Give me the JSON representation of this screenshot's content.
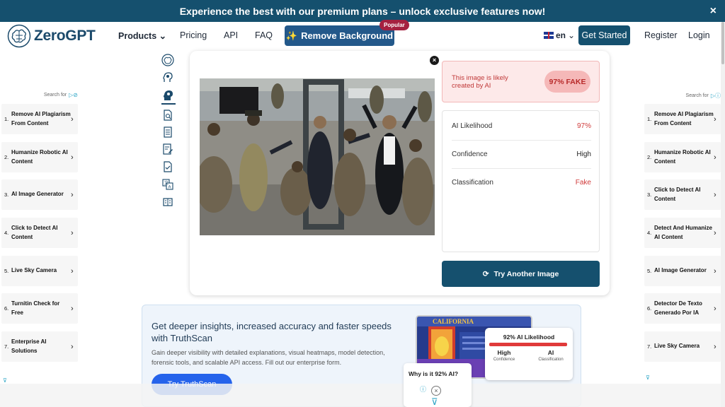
{
  "banner": {
    "text": "Experience the best with our premium plans – unlock exclusive features now!",
    "close": "×"
  },
  "header": {
    "logo": "ZeroGPT",
    "nav": {
      "products": "Products",
      "pricing": "Pricing",
      "api": "API",
      "faq": "FAQ"
    },
    "remove_background": "Remove Background",
    "popular": "Popular",
    "language": "en",
    "get_started": "Get Started",
    "register": "Register",
    "login": "Login"
  },
  "ads_left": {
    "search_for": "Search for",
    "items": [
      {
        "num": "1.",
        "label": "Remove AI Plagiarism From Content"
      },
      {
        "num": "2.",
        "label": "Humanize Robotic AI Content"
      },
      {
        "num": "3.",
        "label": "AI Image Generator"
      },
      {
        "num": "4.",
        "label": "Click to Detect AI Content"
      },
      {
        "num": "5.",
        "label": "Live Sky Camera"
      },
      {
        "num": "6.",
        "label": "Turnitin Check for Free"
      },
      {
        "num": "7.",
        "label": "Enterprise AI Solutions"
      }
    ]
  },
  "ads_right": {
    "search_for": "Search for",
    "items": [
      {
        "num": "1.",
        "label": "Remove AI Plagiarism From Content"
      },
      {
        "num": "2.",
        "label": "Humanize Robotic AI Content"
      },
      {
        "num": "3.",
        "label": "Click to Detect AI Content"
      },
      {
        "num": "4.",
        "label": "Detect And Humanize AI Content"
      },
      {
        "num": "5.",
        "label": "AI Image Generator"
      },
      {
        "num": "6.",
        "label": "Detector De Texto Generado Por IA"
      },
      {
        "num": "7.",
        "label": "Live Sky Camera"
      }
    ]
  },
  "result": {
    "verdict_text": "This image is likely created by AI",
    "verdict_score": "97% FAKE",
    "stats": [
      {
        "label": "AI Likelihood",
        "value": "97%"
      },
      {
        "label": "Confidence",
        "value": "High"
      },
      {
        "label": "Classification",
        "value": "Fake"
      }
    ],
    "try_another": "Try Another Image"
  },
  "promo": {
    "title": "Get deeper insights, increased accuracy and faster speeds with TruthScan",
    "description": "Gain deeper visibility with detailed explanations, visual heatmaps, model detection, forensic tools, and scalable API access. Fill out our enterprise form.",
    "button": "Try TruthScan",
    "card_title": "92% AI Likelihood",
    "card_high": "High",
    "card_confidence": "Confidence",
    "card_ai": "AI",
    "card_classification": "Classification",
    "license_state": "CALIFORNIA",
    "why": "Why is it 92% AI?"
  },
  "colors": {
    "brand": "#15506e",
    "fake_red": "#d03c3c",
    "promo_blue": "#2563eb"
  }
}
